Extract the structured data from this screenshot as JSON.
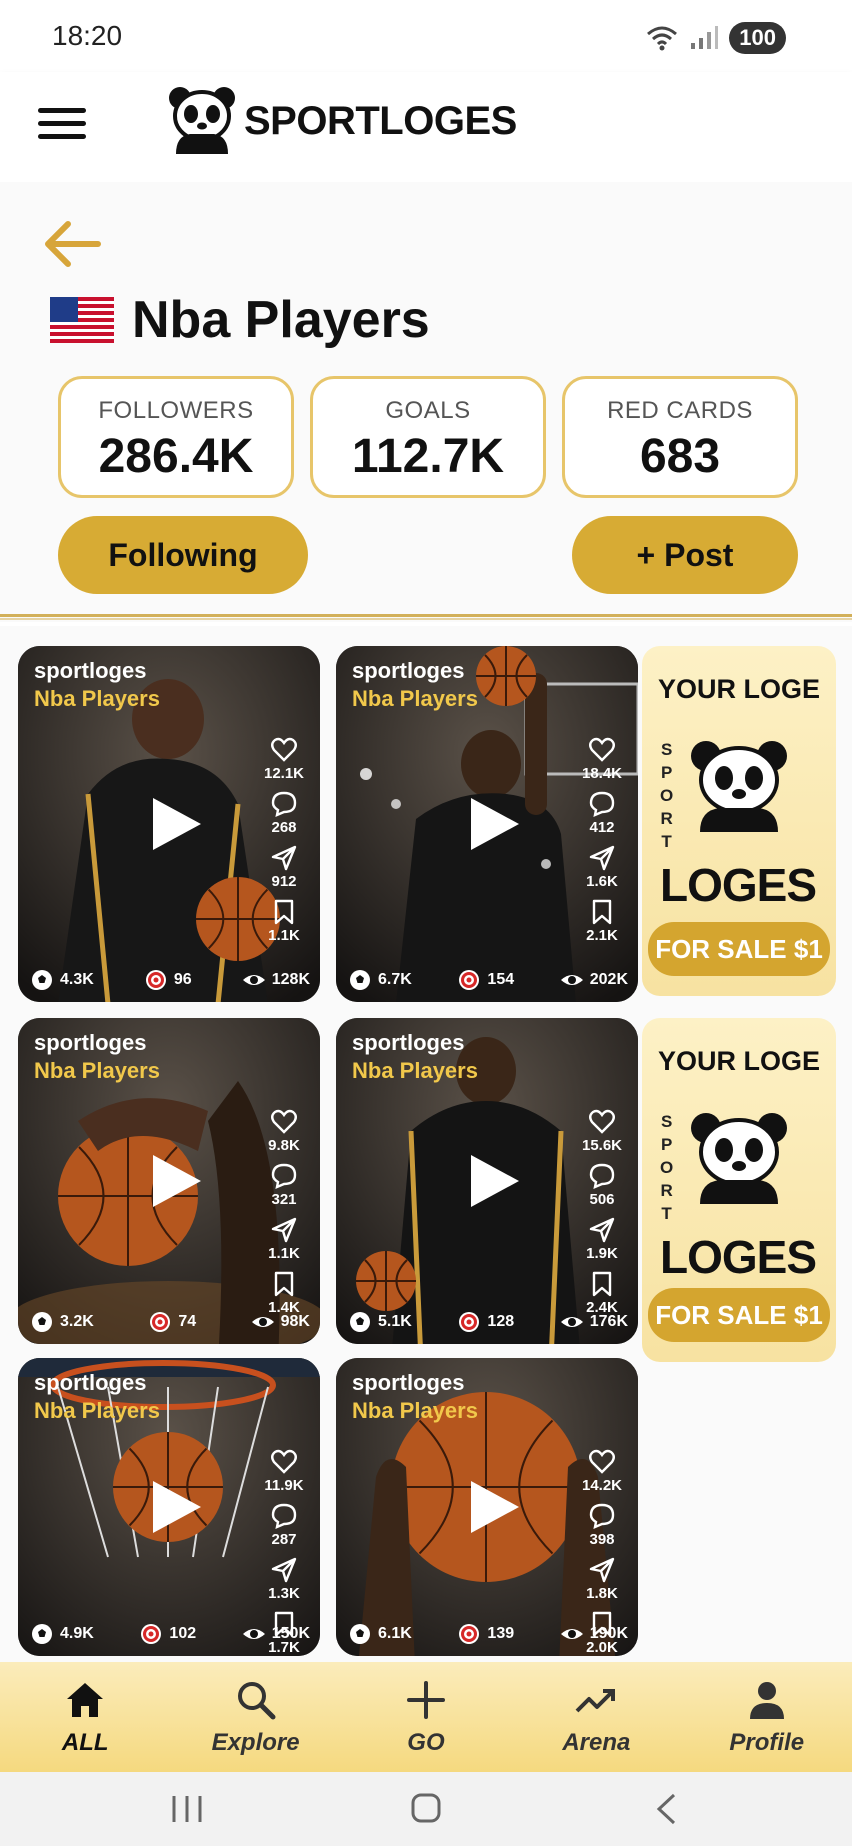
{
  "status": {
    "time": "18:20",
    "battery": "100"
  },
  "app": {
    "logo_text": "SPORTLOGES"
  },
  "profile": {
    "title": "Nba Players",
    "stats": [
      {
        "label": "FOLLOWERS",
        "value": "286.4K"
      },
      {
        "label": "GOALS",
        "value": "112.7K"
      },
      {
        "label": "RED CARDS",
        "value": "683"
      }
    ],
    "following_label": "Following",
    "post_label": "+ Post"
  },
  "posts": [
    {
      "user": "sportloges",
      "tag": "Nba Players",
      "likes": "12.1K",
      "comments": "268",
      "shares": "912",
      "saves": "1.1K",
      "goals": "4.3K",
      "targets": "96",
      "views": "128K",
      "scene": "player-dribble"
    },
    {
      "user": "sportloges",
      "tag": "Nba Players",
      "likes": "18.4K",
      "comments": "412",
      "shares": "1.6K",
      "saves": "2.1K",
      "goals": "6.7K",
      "targets": "154",
      "views": "202K",
      "scene": "player-dunk"
    },
    {
      "user": "sportloges",
      "tag": "Nba Players",
      "likes": "9.8K",
      "comments": "321",
      "shares": "1.1K",
      "saves": "1.4K",
      "goals": "3.2K",
      "targets": "74",
      "views": "98K",
      "scene": "ball-hand"
    },
    {
      "user": "sportloges",
      "tag": "Nba Players",
      "likes": "15.6K",
      "comments": "506",
      "shares": "1.9K",
      "saves": "2.4K",
      "goals": "5.1K",
      "targets": "128",
      "views": "176K",
      "scene": "player-back"
    },
    {
      "user": "sportloges",
      "tag": "Nba Players",
      "likes": "11.9K",
      "comments": "287",
      "shares": "1.3K",
      "saves": "1.7K",
      "goals": "4.9K",
      "targets": "102",
      "views": "150K",
      "scene": "ball-hoop"
    },
    {
      "user": "sportloges",
      "tag": "Nba Players",
      "likes": "14.2K",
      "comments": "398",
      "shares": "1.8K",
      "saves": "2.0K",
      "goals": "6.1K",
      "targets": "139",
      "views": "190K",
      "scene": "ball-hold"
    }
  ],
  "ads": [
    {
      "heading": "YOUR LOGE",
      "vertical": "SPORT",
      "brand": "LOGES",
      "cta": "FOR SALE $1"
    },
    {
      "heading": "YOUR LOGE",
      "vertical": "SPORT",
      "brand": "LOGES",
      "cta": "FOR SALE $1"
    }
  ],
  "nav": [
    {
      "label": "ALL",
      "icon": "home-icon",
      "active": true
    },
    {
      "label": "Explore",
      "icon": "search-icon",
      "active": false
    },
    {
      "label": "GO",
      "icon": "plus-icon",
      "active": false
    },
    {
      "label": "Arena",
      "icon": "trending-icon",
      "active": false
    },
    {
      "label": "Profile",
      "icon": "person-icon",
      "active": false
    }
  ],
  "colors": {
    "accent": "#d7ab34",
    "accent_light": "#fbecbb",
    "tag_yellow": "#f1c84b"
  }
}
